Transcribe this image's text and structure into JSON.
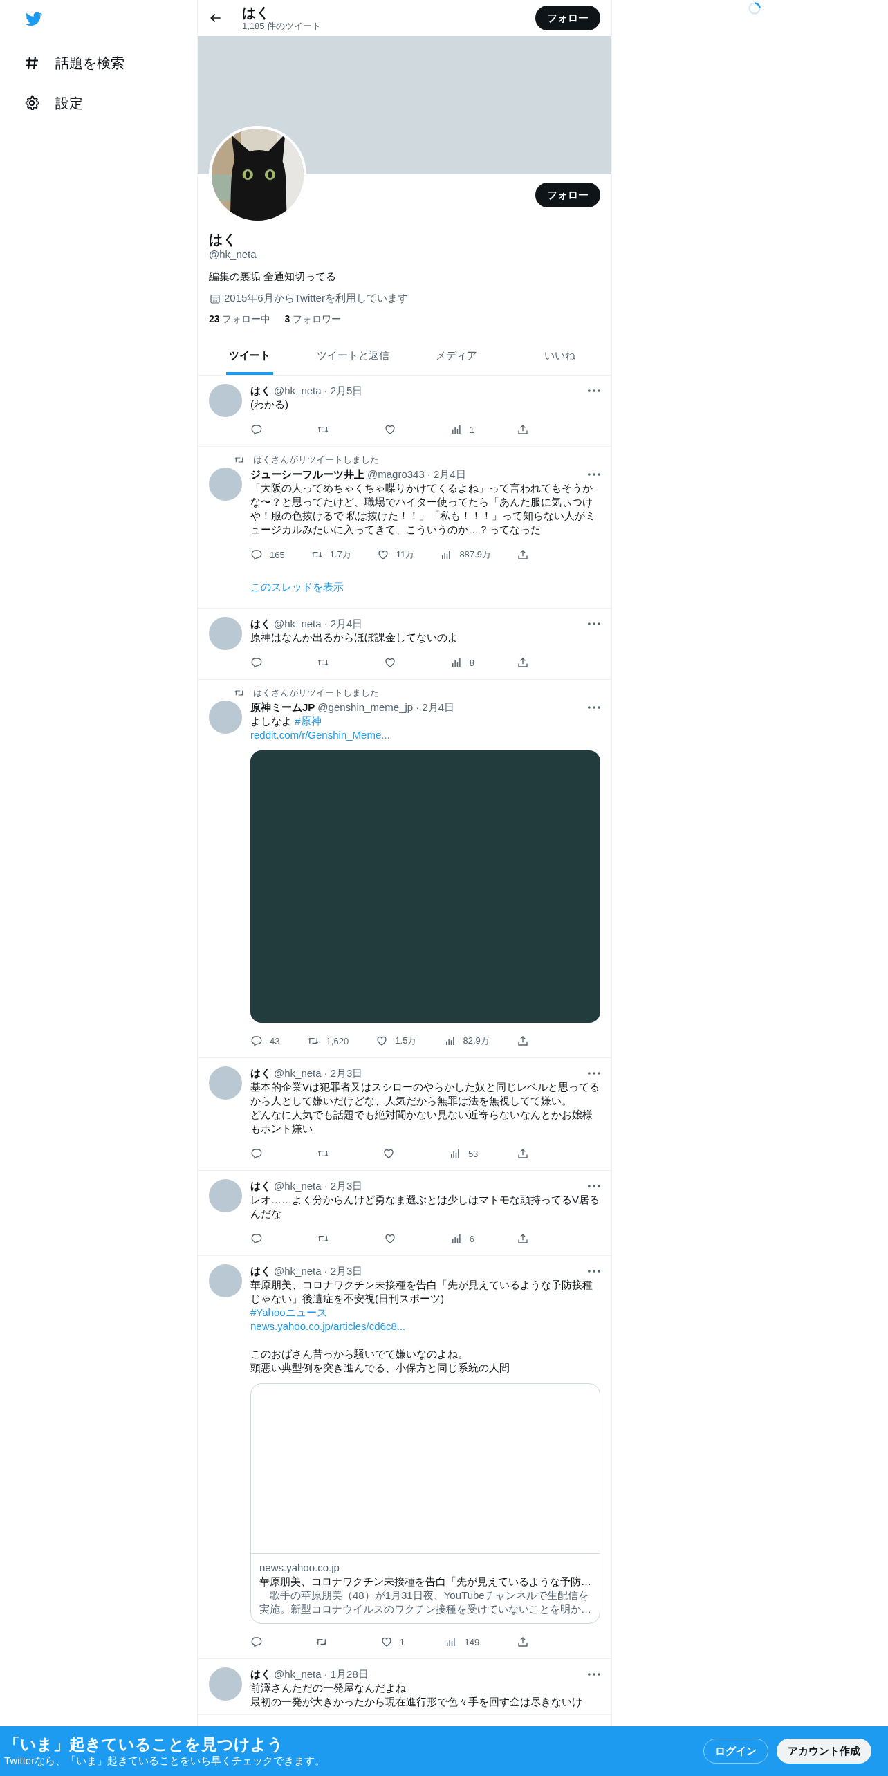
{
  "sidebar": {
    "items": [
      {
        "kind": "hashtag",
        "label": "話題を検索"
      },
      {
        "kind": "settings",
        "label": "設定"
      }
    ]
  },
  "header": {
    "title": "はく",
    "subtitle": "1,185 件のツイート",
    "follow_button": "フォロー"
  },
  "profile": {
    "follow_button": "フォロー",
    "name": "はく",
    "handle": "@hk_neta",
    "bio": "編集の裏垢 全通知切ってる",
    "joined": "2015年6月からTwitterを利用しています",
    "stats": [
      {
        "count": "23",
        "label": "フォロー中"
      },
      {
        "count": "3",
        "label": "フォロワー"
      }
    ]
  },
  "tabs": [
    {
      "label": "ツイート",
      "selected": true
    },
    {
      "label": "ツイートと返信",
      "selected": false
    },
    {
      "label": "メディア",
      "selected": false
    },
    {
      "label": "いいね",
      "selected": false
    }
  ],
  "tweets": [
    {
      "name": "はく",
      "handle": "@hk_neta",
      "date": "· 2月5日",
      "blocks": [
        {
          "parts": [
            {
              "kind": "plain",
              "text": "(わかる)"
            }
          ]
        }
      ],
      "actions": [
        {
          "kind": "reply"
        },
        {
          "kind": "retweet"
        },
        {
          "kind": "like"
        },
        {
          "kind": "views",
          "count": "1"
        },
        {
          "kind": "share"
        }
      ]
    },
    {
      "retweeted_by": "はくさんがリツイートしました",
      "name": "ジューシーフルーツ井上",
      "handle": "@magro343",
      "date": "· 2月4日",
      "blocks": [
        {
          "parts": [
            {
              "kind": "plain",
              "text": "「大阪の人ってめちゃくちゃ喋りかけてくるよね」って言われてもそうかな〜？と思ってたけど、職場でハイター使ってたら「あんた服に気ぃつけや！服の色抜けるで 私は抜けた！！」「私も！！！」って知らない人がミュージカルみたいに入ってきて、こういうのか…？ってなった"
            }
          ]
        }
      ],
      "actions": [
        {
          "kind": "reply",
          "count": "165"
        },
        {
          "kind": "retweet",
          "count": "1.7万"
        },
        {
          "kind": "like",
          "count": "11万"
        },
        {
          "kind": "views",
          "count": "887.9万"
        },
        {
          "kind": "share"
        }
      ],
      "thread_link": "このスレッドを表示"
    },
    {
      "name": "はく",
      "handle": "@hk_neta",
      "date": "· 2月4日",
      "blocks": [
        {
          "parts": [
            {
              "kind": "plain",
              "text": "原神はなんか出るからほぼ課金してないのよ"
            }
          ]
        }
      ],
      "actions": [
        {
          "kind": "reply"
        },
        {
          "kind": "retweet"
        },
        {
          "kind": "like"
        },
        {
          "kind": "views",
          "count": "8"
        },
        {
          "kind": "share"
        }
      ]
    },
    {
      "retweeted_by": "はくさんがリツイートしました",
      "name": "原神ミームJP",
      "handle": "@genshin_meme_jp",
      "date": "· 2月4日",
      "blocks": [
        {
          "parts": [
            {
              "kind": "plain",
              "text": "よしなよ "
            },
            {
              "kind": "link",
              "text": "#原神"
            }
          ]
        },
        {
          "parts": [
            {
              "kind": "link",
              "text": "reddit.com/r/Genshin_Meme..."
            }
          ]
        }
      ],
      "media": {
        "kind": "video"
      },
      "actions": [
        {
          "kind": "reply",
          "count": "43"
        },
        {
          "kind": "retweet",
          "count": "1,620"
        },
        {
          "kind": "like",
          "count": "1.5万"
        },
        {
          "kind": "views",
          "count": "82.9万"
        },
        {
          "kind": "share"
        }
      ]
    },
    {
      "name": "はく",
      "handle": "@hk_neta",
      "date": "· 2月3日",
      "blocks": [
        {
          "parts": [
            {
              "kind": "plain",
              "text": "基本的企業Vは犯罪者又はスシローのやらかした奴と同じレベルと思ってるから人として嫌いだけどな、人気だから無罪は法を無視してて嫌い。"
            }
          ]
        },
        {
          "parts": [
            {
              "kind": "plain",
              "text": "どんなに人気でも話題でも絶対聞かない見ない近寄らないなんとかお嬢様もホント嫌い"
            }
          ]
        }
      ],
      "actions": [
        {
          "kind": "reply"
        },
        {
          "kind": "retweet"
        },
        {
          "kind": "like"
        },
        {
          "kind": "views",
          "count": "53"
        },
        {
          "kind": "share"
        }
      ]
    },
    {
      "name": "はく",
      "handle": "@hk_neta",
      "date": "· 2月3日",
      "blocks": [
        {
          "parts": [
            {
              "kind": "plain",
              "text": "レオ……よく分からんけど勇なま選ぶとは少しはマトモな頭持ってるV居るんだな"
            }
          ]
        }
      ],
      "actions": [
        {
          "kind": "reply"
        },
        {
          "kind": "retweet"
        },
        {
          "kind": "like"
        },
        {
          "kind": "views",
          "count": "6"
        },
        {
          "kind": "share"
        }
      ]
    },
    {
      "name": "はく",
      "handle": "@hk_neta",
      "date": "· 2月3日",
      "blocks": [
        {
          "parts": [
            {
              "kind": "plain",
              "text": "華原朋美、コロナワクチン未接種を告白「先が見えているような予防接種じゃない」後遺症を不安視(日刊スポーツ)"
            }
          ]
        },
        {
          "parts": [
            {
              "kind": "link",
              "text": "#Yahooニュース"
            }
          ]
        },
        {
          "parts": [
            {
              "kind": "link",
              "text": "news.yahoo.co.jp/articles/cd6c8..."
            }
          ]
        },
        {
          "space_before": true,
          "parts": [
            {
              "kind": "plain",
              "text": "このおばさん昔っから騒いでて嫌いなのよね。"
            }
          ]
        },
        {
          "parts": [
            {
              "kind": "plain",
              "text": "頭悪い典型例を突き進んでる、小保方と同じ系統の人間"
            }
          ]
        }
      ],
      "card": {
        "domain": "news.yahoo.co.jp",
        "title": "華原朋美、コロナワクチン未接種を告白「先が見えているような予防…",
        "description": "　歌手の華原朋美（48）が1月31日夜、YouTubeチャンネルで生配信を実施。新型コロナウイルスのワクチン接種を受けていないことを明か…"
      },
      "actions": [
        {
          "kind": "reply"
        },
        {
          "kind": "retweet"
        },
        {
          "kind": "like",
          "count": "1"
        },
        {
          "kind": "views",
          "count": "149"
        },
        {
          "kind": "share"
        }
      ]
    },
    {
      "name": "はく",
      "handle": "@hk_neta",
      "date": "· 1月28日",
      "blocks": [
        {
          "parts": [
            {
              "kind": "plain",
              "text": "前澤さんただの一発屋なんだよね"
            }
          ]
        },
        {
          "parts": [
            {
              "kind": "plain",
              "text": "最初の一発が大きかったから現在進行形で色々手を回す金は尽きないけ"
            }
          ]
        }
      ]
    }
  ],
  "bottom_bar": {
    "title": "「いま」起きていることを見つけよう",
    "subtitle": "Twitterなら、「いま」起きていることをいち早くチェックできます。",
    "buttons": [
      {
        "kind": "outline",
        "label": "ログイン"
      },
      {
        "kind": "filled",
        "label": "アカウント作成"
      }
    ]
  }
}
